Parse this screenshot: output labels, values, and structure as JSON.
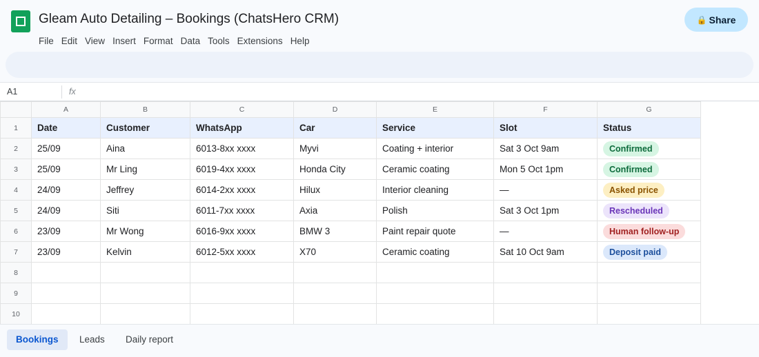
{
  "title": "Gleam Auto Detailing – Bookings (ChatsHero CRM)",
  "menu": [
    "File",
    "Edit",
    "View",
    "Insert",
    "Format",
    "Data",
    "Tools",
    "Extensions",
    "Help"
  ],
  "share": {
    "icon": "lock-icon",
    "label": "Share"
  },
  "formula_bar": {
    "cell_ref": "A1",
    "fx": "fx"
  },
  "columns": [
    "A",
    "B",
    "C",
    "D",
    "E",
    "F",
    "G"
  ],
  "rows": [
    {
      "num": "1",
      "cells": [
        "Date",
        "Customer",
        "WhatsApp",
        "Car",
        "Service",
        "Slot",
        "Status"
      ]
    },
    {
      "num": "2",
      "cells": [
        "25/09",
        "Aina",
        "6013-8xx xxxx",
        "Myvi",
        "Coating + interior",
        "Sat 3 Oct 9am",
        "Confirmed"
      ]
    },
    {
      "num": "3",
      "cells": [
        "25/09",
        "Mr Ling",
        "6019-4xx xxxx",
        "Honda City",
        "Ceramic coating",
        "Mon 5 Oct 1pm",
        "Confirmed"
      ]
    },
    {
      "num": "4",
      "cells": [
        "24/09",
        "Jeffrey",
        "6014-2xx xxxx",
        "Hilux",
        "Interior cleaning",
        "—",
        "Asked price"
      ]
    },
    {
      "num": "5",
      "cells": [
        "24/09",
        "Siti",
        "6011-7xx xxxx",
        "Axia",
        "Polish",
        "Sat 3 Oct 1pm",
        "Rescheduled"
      ]
    },
    {
      "num": "6",
      "cells": [
        "23/09",
        "Mr Wong",
        "6016-9xx xxxx",
        "BMW 3",
        "Paint repair quote",
        "—",
        "Human follow-up"
      ]
    },
    {
      "num": "7",
      "cells": [
        "23/09",
        "Kelvin",
        "6012-5xx xxxx",
        "X70",
        "Ceramic coating",
        "Sat 10 Oct 9am",
        "Deposit paid"
      ]
    },
    {
      "num": "8",
      "cells": [
        "",
        "",
        "",
        "",
        "",
        "",
        ""
      ]
    },
    {
      "num": "9",
      "cells": [
        "",
        "",
        "",
        "",
        "",
        "",
        ""
      ]
    },
    {
      "num": "10",
      "cells": [
        "",
        "",
        "",
        "",
        "",
        "",
        ""
      ]
    }
  ],
  "status_colors": {
    "Confirmed": {
      "bg": "#d6f5e3",
      "fg": "#0d6b3c"
    },
    "Asked price": {
      "bg": "#fdefc3",
      "fg": "#8a5300"
    },
    "Rescheduled": {
      "bg": "#ece4fb",
      "fg": "#6a35b8"
    },
    "Human follow-up": {
      "bg": "#fbdcdc",
      "fg": "#a12222"
    },
    "Deposit paid": {
      "bg": "#dbe8fb",
      "fg": "#1d4f9c"
    }
  },
  "sheet_tabs": [
    {
      "label": "Bookings",
      "active": true
    },
    {
      "label": "Leads",
      "active": false
    },
    {
      "label": "Daily report",
      "active": false
    }
  ]
}
